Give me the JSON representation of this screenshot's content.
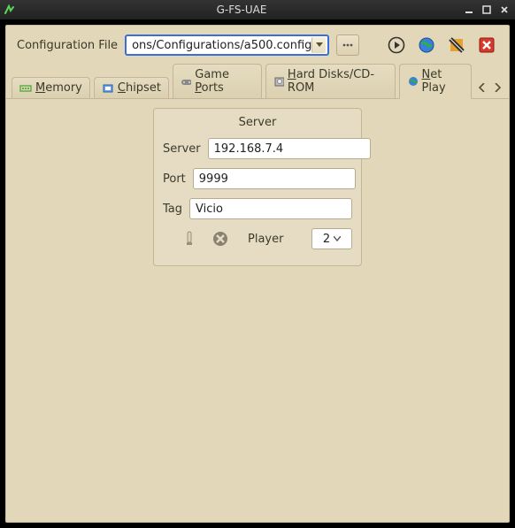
{
  "window": {
    "title": "G-FS-UAE"
  },
  "toolbar": {
    "config_label": "Configuration File",
    "config_path": "ons/Configurations/a500.config"
  },
  "tabs": {
    "items": [
      {
        "label": "Memory",
        "underline": "M",
        "rest": "emory"
      },
      {
        "label": "Chipset",
        "underline": "C",
        "rest": "hipset"
      },
      {
        "label": "Game Ports",
        "prefix": "Game ",
        "underline": "P",
        "rest": "orts"
      },
      {
        "label": "Hard Disks/CD-ROM",
        "underline": "H",
        "rest": "ard Disks/CD-ROM"
      },
      {
        "label": "Net Play",
        "underline": "N",
        "rest": "et Play"
      }
    ],
    "active_index": 4
  },
  "netplay": {
    "panel_title": "Server",
    "server_label": "Server",
    "server_value": "192.168.7.4",
    "port_label": "Port",
    "port_value": "9999",
    "tag_label": "Tag",
    "tag_value": "Vicio",
    "player_label": "Player",
    "player_value": "2"
  }
}
